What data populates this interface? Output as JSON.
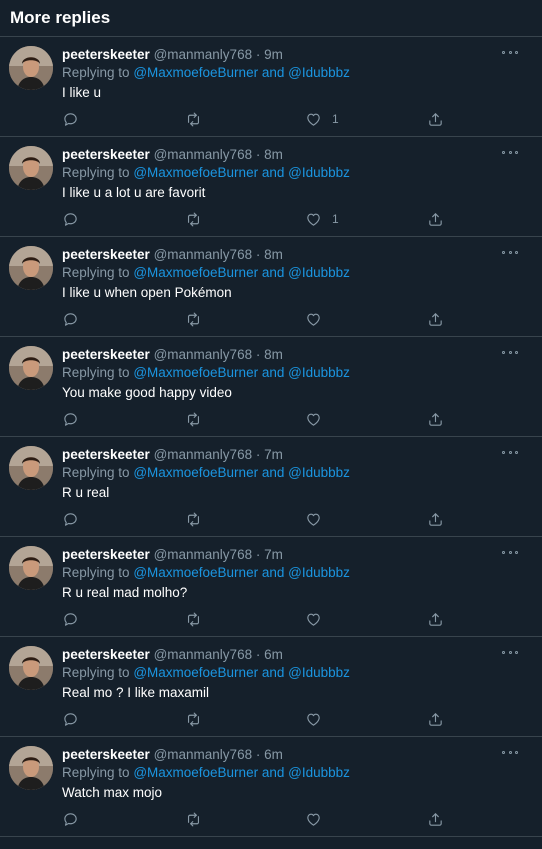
{
  "header": {
    "title": "More replies"
  },
  "replying_prefix": "Replying to",
  "mentions": {
    "first": "@MaxmoefoeBurner",
    "joiner": "and",
    "second": "@Idubbbz"
  },
  "tweets": [
    {
      "name": "peeterskeeter",
      "handle": "@manmanly768",
      "dot": "·",
      "time": "9m",
      "text": "I like u",
      "likes": "1"
    },
    {
      "name": "peeterskeeter",
      "handle": "@manmanly768",
      "dot": "·",
      "time": "8m",
      "text": "I like u a lot u are favorit",
      "likes": "1"
    },
    {
      "name": "peeterskeeter",
      "handle": "@manmanly768",
      "dot": "·",
      "time": "8m",
      "text": "I like u when open Pokémon",
      "likes": ""
    },
    {
      "name": "peeterskeeter",
      "handle": "@manmanly768",
      "dot": "·",
      "time": "8m",
      "text": "You make good happy video",
      "likes": ""
    },
    {
      "name": "peeterskeeter",
      "handle": "@manmanly768",
      "dot": "·",
      "time": "7m",
      "text": "R u real",
      "likes": ""
    },
    {
      "name": "peeterskeeter",
      "handle": "@manmanly768",
      "dot": "·",
      "time": "7m",
      "text": "R u real mad molho?",
      "likes": ""
    },
    {
      "name": "peeterskeeter",
      "handle": "@manmanly768",
      "dot": "·",
      "time": "6m",
      "text": "Real mo ? I like maxamil",
      "likes": ""
    },
    {
      "name": "peeterskeeter",
      "handle": "@manmanly768",
      "dot": "·",
      "time": "6m",
      "text": "Watch max mojo",
      "likes": ""
    }
  ],
  "icons": {
    "reply": "reply-icon",
    "retweet": "retweet-icon",
    "like": "heart-icon",
    "share": "share-icon",
    "more": "more-options-icon"
  },
  "colors": {
    "background": "#15202b",
    "link": "#1b95e0",
    "muted": "#8899a6",
    "border": "#38444d"
  }
}
